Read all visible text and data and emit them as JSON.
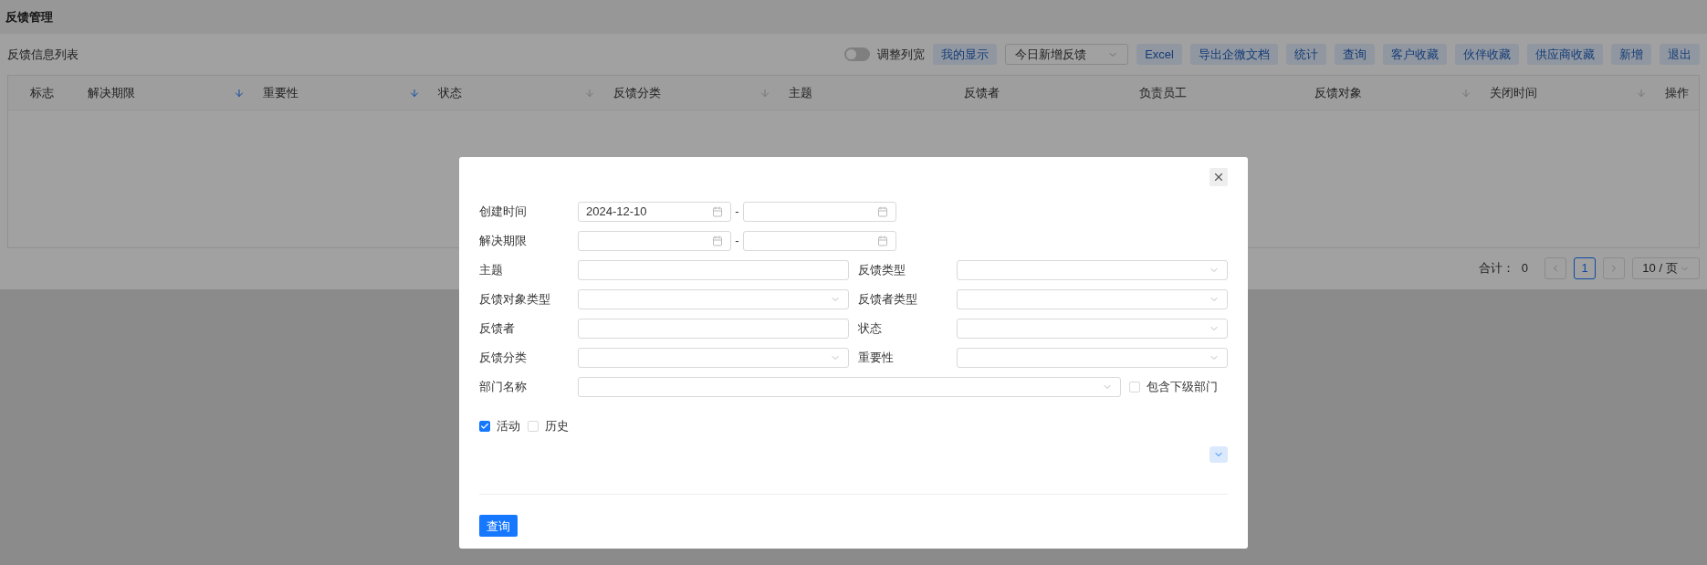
{
  "page": {
    "title": "反馈管理"
  },
  "list": {
    "title": "反馈信息列表",
    "toolbar": [
      {
        "kind": "toggle",
        "label": "调整列宽",
        "on": false
      },
      {
        "kind": "button",
        "label": "我的显示"
      },
      {
        "kind": "select",
        "value": "今日新增反馈"
      },
      {
        "kind": "button",
        "label": "Excel"
      },
      {
        "kind": "button",
        "label": "导出企微文档"
      },
      {
        "kind": "button",
        "label": "统计"
      },
      {
        "kind": "button",
        "label": "查询"
      },
      {
        "kind": "button",
        "label": "客户收藏"
      },
      {
        "kind": "button",
        "label": "伙伴收藏"
      },
      {
        "kind": "button",
        "label": "供应商收藏"
      },
      {
        "kind": "button",
        "label": "新增"
      },
      {
        "kind": "button",
        "label": "退出"
      }
    ],
    "table": {
      "columns": [
        {
          "label": "标志",
          "sortable": false
        },
        {
          "label": "解决期限",
          "sortable": true,
          "sort_active": true
        },
        {
          "label": "重要性",
          "sortable": true,
          "sort_active": true
        },
        {
          "label": "状态",
          "sortable": true,
          "sort_active": false
        },
        {
          "label": "反馈分类",
          "sortable": true,
          "sort_active": false
        },
        {
          "label": "主题",
          "sortable": false
        },
        {
          "label": "反馈者",
          "sortable": false
        },
        {
          "label": "负责员工",
          "sortable": false
        },
        {
          "label": "反馈对象",
          "sortable": true,
          "sort_active": false
        },
        {
          "label": "关闭时间",
          "sortable": true,
          "sort_active": false
        },
        {
          "label": "操作",
          "sortable": false
        }
      ]
    },
    "pagination": {
      "total_label": "合计：",
      "total": "0",
      "pages": [
        {
          "label": "1",
          "selected": true
        }
      ],
      "page_size": "10 / 页"
    }
  },
  "dialog": {
    "rows": [
      [
        {
          "kind": "date_range",
          "label": "创建时间",
          "start": "2024-12-10",
          "separator": "-"
        }
      ],
      [
        {
          "kind": "date_range",
          "label": "解决期限",
          "separator": "-"
        }
      ],
      [
        {
          "kind": "input",
          "label": "主题"
        },
        {
          "kind": "select",
          "label": "反馈类型"
        }
      ],
      [
        {
          "kind": "select",
          "label": "反馈对象类型"
        },
        {
          "kind": "select",
          "label": "反馈者类型"
        }
      ],
      [
        {
          "kind": "input",
          "label": "反馈者"
        },
        {
          "kind": "select",
          "label": "状态"
        }
      ],
      [
        {
          "kind": "select",
          "label": "反馈分类"
        },
        {
          "kind": "select",
          "label": "重要性"
        }
      ],
      [
        {
          "kind": "wide_select",
          "label": "部门名称",
          "checkbox": {
            "label": "包含下级部门",
            "checked": false
          }
        }
      ]
    ],
    "checkboxes": [
      {
        "label": "活动",
        "checked": true
      },
      {
        "label": "历史",
        "checked": false
      }
    ],
    "expanded": false,
    "submit": "查询"
  }
}
